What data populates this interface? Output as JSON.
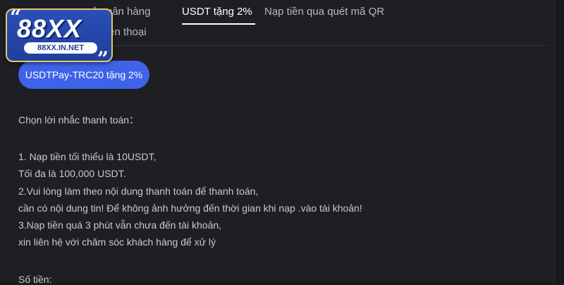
{
  "logo": {
    "brand": "88XX",
    "url": "88XX.IN.NET"
  },
  "tabs": [
    {
      "label": "ẻ ngân hàng",
      "active": false
    },
    {
      "label": "USDT tặng 2%",
      "active": true
    },
    {
      "label": "Nạp tiền qua quét mã QR",
      "active": false
    },
    {
      "label": "o điện thoại",
      "active": false
    }
  ],
  "pay_method": {
    "label": "USDTPay-TRC20 tặng 2%"
  },
  "instructions": {
    "title": "Chọn lời nhắc thanh toán：",
    "lines": [
      "1. Nạp tiền tối thiểu là 10USDT,",
      "Tối đa là 100,000 USDT.",
      "2.Vui lòng làm theo nội dung thanh toán để thanh toán,",
      "cần có nội dung tin! Để không ảnh hưởng đến thời gian khi nạp .vào tài khoản!",
      "3.Nạp tiền quá 3 phút vẫn chưa đến tài khoản,",
      "xin liên hệ với chăm sóc khách hàng để xử lý"
    ]
  },
  "amount_label": "Số tiền:",
  "colors": {
    "accent": "#3e63e8",
    "background": "#1e1f23",
    "logo_blue": "#2a4fb8",
    "logo_gold": "#e7c86a"
  }
}
